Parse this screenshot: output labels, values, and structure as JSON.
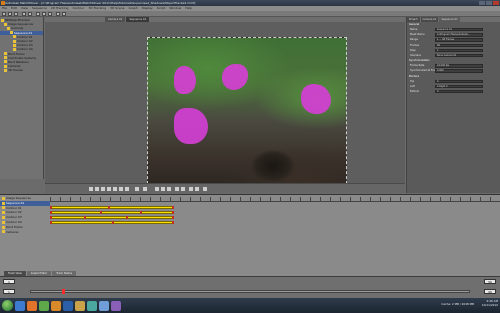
{
  "window": {
    "title": "Autodesk MatchMover - [C:\\Program Files\\Autodesk\\MatchMover 2011\\Help\\Tutorials\\Supervised_Shadows\\ObjectTracked.mmf]"
  },
  "menubar": {
    "items": [
      "File",
      "Edit",
      "View",
      "Sequence",
      "2D Tracking",
      "Contour",
      "3D Tracking",
      "3D Scene",
      "Graph",
      "Display",
      "Script",
      "Window",
      "Help"
    ]
  },
  "tree": {
    "items": [
      {
        "label": "MMObjectTracked",
        "sel": false
      },
      {
        "label": "Image Sequences",
        "sel": false
      },
      {
        "label": "Anomaly",
        "sel": false
      },
      {
        "label": "Sequence 01",
        "sel": true
      },
      {
        "label": "Contour 01",
        "sel": false
      },
      {
        "label": "Contour 02",
        "sel": false
      },
      {
        "label": "Contour 03",
        "sel": false
      },
      {
        "label": "Contour 04",
        "sel": false
      },
      {
        "label": "Point Tracks",
        "sel": false
      },
      {
        "label": "Coordinate Systems",
        "sel": false
      },
      {
        "label": "Point Relations",
        "sel": false
      },
      {
        "label": "Cameras",
        "sel": false
      },
      {
        "label": "3D Scenes",
        "sel": false
      }
    ]
  },
  "viewer": {
    "tabs": [
      "Camera 01",
      "Sequence 01"
    ]
  },
  "properties": {
    "tabs": [
      "Project",
      "Camera 01",
      "Sequence 01"
    ],
    "general_head": "General",
    "rows": [
      {
        "label": "Name",
        "value": "Sequence 01"
      },
      {
        "label": "Mask Name",
        "value": "C:\\Program Files\\Autodesk\\..."
      },
      {
        "label": "Range",
        "value": "1   ...   96 Frames"
      },
      {
        "label": "Frames",
        "value": "96"
      },
      {
        "label": "Step",
        "value": "1"
      },
      {
        "label": "Interlace",
        "value": "None   Camera 01"
      }
    ],
    "sync_head": "Synchronization",
    "sync_rows": [
      {
        "label": "Frame Rate",
        "value": "24.000   fps"
      },
      {
        "label": "Synchronized at Frame",
        "value": "0.000"
      }
    ],
    "borders_head": "Borders",
    "border_rows": [
      {
        "label": "Top",
        "value": "0"
      },
      {
        "label": "Left",
        "value": "0      Right  0"
      },
      {
        "label": "Bottom",
        "value": "0"
      }
    ]
  },
  "timeline": {
    "labels": [
      {
        "label": "Image Sequences",
        "sel": false
      },
      {
        "label": "Sequence 01",
        "sel": true
      },
      {
        "label": "Contour 01",
        "sel": false
      },
      {
        "label": "Contour 02",
        "sel": false
      },
      {
        "label": "Contour 03",
        "sel": false
      },
      {
        "label": "Contour 04",
        "sel": false
      },
      {
        "label": "Point Tracks",
        "sel": false
      },
      {
        "label": "Cameras",
        "sel": false
      }
    ],
    "tabs": [
      "Track View",
      "Graph Editor",
      "Track Status"
    ]
  },
  "playback": {
    "start_frame": "1",
    "current_frame": "1",
    "end_frame": "96",
    "current_frame_right": "96"
  },
  "status": {
    "cache": "Cache: 2 MB / 2048 MB"
  },
  "clock": {
    "time": "9:46 AM",
    "date": "10/11/2010"
  },
  "taskbar": {
    "icons": [
      "explorer-icon",
      "firefox-icon",
      "media-icon",
      "illustrator-icon",
      "photoshop-icon",
      "folder-icon",
      "matchmover-icon",
      "maya-icon",
      "app-icon"
    ]
  }
}
